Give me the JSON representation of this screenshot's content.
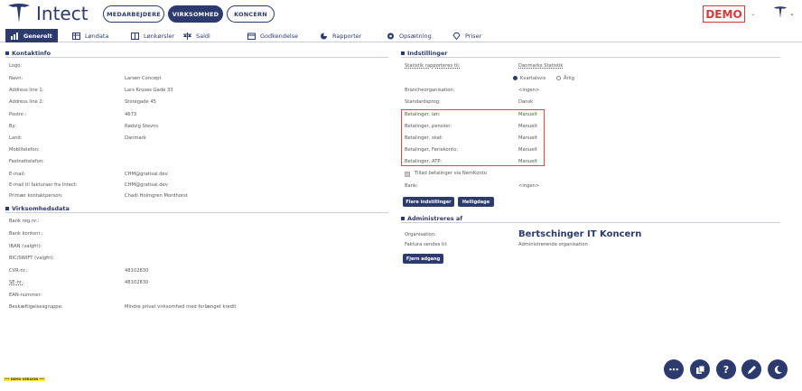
{
  "header": {
    "brand": "Intect",
    "pills": [
      "MEDARBEJDERE",
      "VIRKSOMHED",
      "KONCERN"
    ],
    "demo_label": "DEMO"
  },
  "nav": {
    "items": [
      "Generelt",
      "Løndata",
      "Lønkørsler",
      "Saldi",
      "Godkendelse",
      "Rapporter",
      "Opsætning",
      "Priser"
    ]
  },
  "contact": {
    "title": "Kontaktinfo",
    "rows": [
      {
        "label": "Logo:",
        "value": ""
      },
      {
        "label": "Navn:",
        "value": "Larsen Concept"
      },
      {
        "label": "Address line 1:",
        "value": "Lars Kruses Gade 33"
      },
      {
        "label": "Address line 2:",
        "value": "Storegade 45"
      },
      {
        "label": "Postnr.:",
        "value": "4673"
      },
      {
        "label": "By:",
        "value": "Rødvig Stevns"
      },
      {
        "label": "Land:",
        "value": "Danmark"
      },
      {
        "label": "Mobiltelefon:",
        "value": ""
      },
      {
        "label": "Fastnettelefon:",
        "value": ""
      },
      {
        "label": "E-mail:",
        "value": "CHM@gratisal.dev"
      },
      {
        "label": "E-mail til fakturaer fra Intect:",
        "value": "CHM@gratisal.dev"
      },
      {
        "label": "Primær kontaktperson:",
        "value": "Chadi Holmgren Mordhorst"
      }
    ]
  },
  "company": {
    "title": "Virksomhedsdata",
    "rows": [
      {
        "label": "Bank reg.nr.:",
        "value": ""
      },
      {
        "label": "Bank kontonr.:",
        "value": ""
      },
      {
        "label": "IBAN (valgfri):",
        "value": ""
      },
      {
        "label": "BIC/SWIFT (valgfri):",
        "value": ""
      },
      {
        "label": "CVR-nr.:",
        "value": "48102830"
      },
      {
        "label": "SE-nr.:",
        "value": "48102830"
      },
      {
        "label": "EAN-nummer:",
        "value": ""
      },
      {
        "label": "Beskæftigelsesgruppe:",
        "value": "Mindre privat virksomhed med forlænget kredit"
      }
    ]
  },
  "settings": {
    "title": "Indstillinger",
    "stat_label": "Statistik rapporteres til:",
    "stat_value": "Danmarks Statistik",
    "radio_quarterly": "Kvartalsvis",
    "radio_yearly": "Årlig",
    "rows": [
      {
        "label": "Brancheorganisation:",
        "value": "<ingen>"
      },
      {
        "label": "Standardsprog:",
        "value": "Dansk"
      },
      {
        "label": "Betalinger, løn:",
        "value": "Manuelt"
      },
      {
        "label": "Betalinger, pension:",
        "value": "Manuelt"
      },
      {
        "label": "Betalinger, skat:",
        "value": "Manuelt"
      },
      {
        "label": "Betalinger, Feriekonto:",
        "value": "Manuelt"
      },
      {
        "label": "Betalinger, ATP:",
        "value": "Manuelt"
      }
    ],
    "nemkonto_label": "Tillad betalinger via NemKonto",
    "bank_label": "Bank:",
    "bank_value": "<ingen>",
    "btn_more": "Flere indstillinger",
    "btn_holidays": "Helligdage"
  },
  "admin": {
    "title": "Administreres af",
    "org_label": "Organisation:",
    "org_value": "Bertschinger IT Koncern",
    "invoice_label": "Faktura sendes til:",
    "invoice_value": "Administrerende organisation",
    "btn_remove": "Fjern adgang"
  },
  "footer": {
    "highlight": "*** DEMO VERSION ***"
  }
}
